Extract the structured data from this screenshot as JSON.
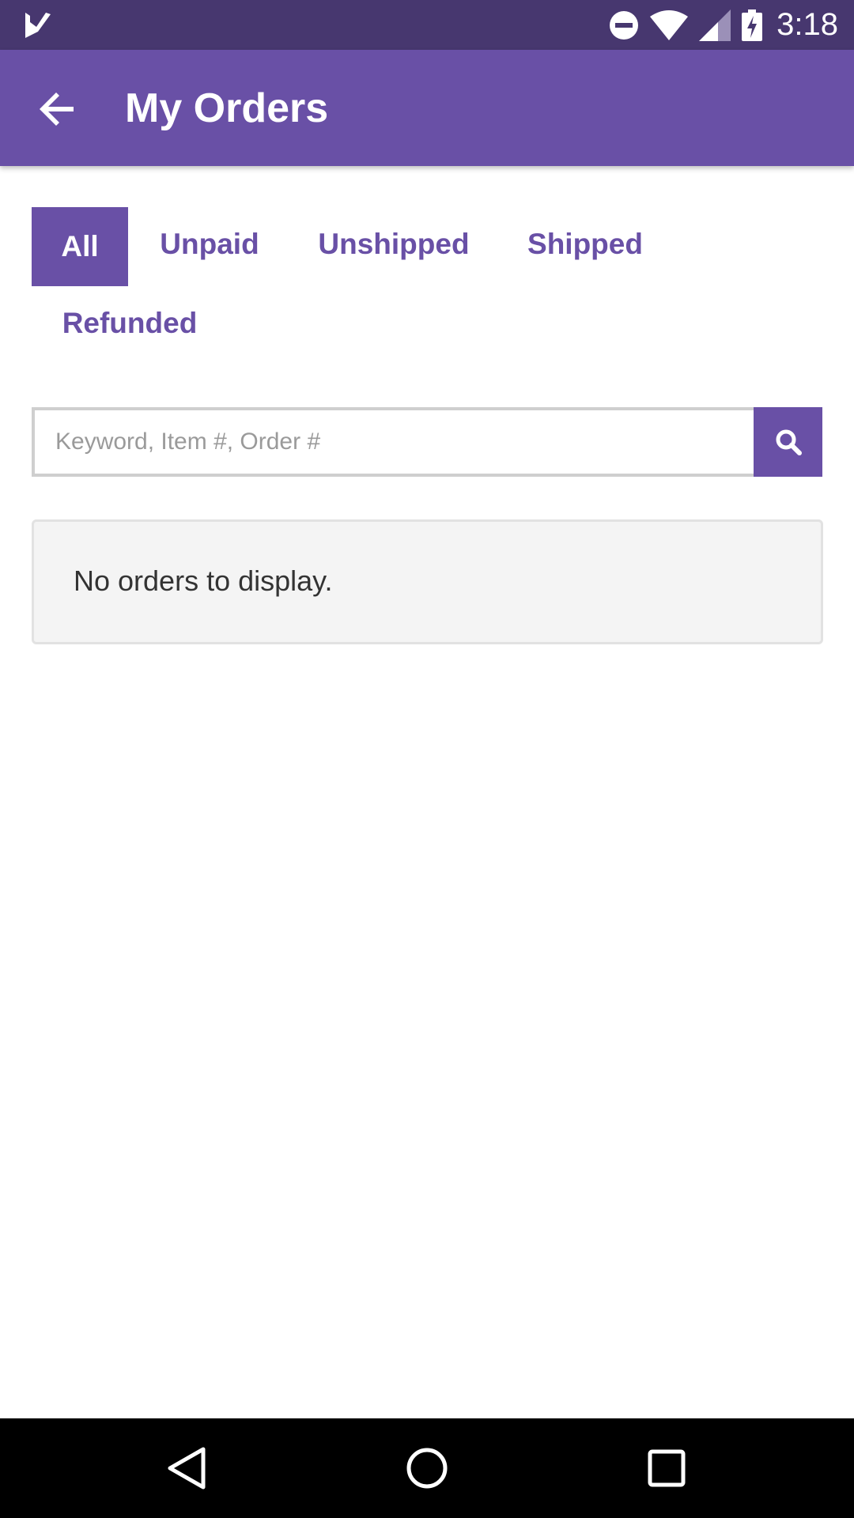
{
  "status_bar": {
    "time": "3:18",
    "icons": [
      "app-check-icon",
      "do-not-disturb-icon",
      "wifi-icon",
      "cell-signal-icon",
      "battery-charging-icon"
    ]
  },
  "app_bar": {
    "title": "My Orders",
    "back_icon": "arrow-back-icon"
  },
  "tabs": [
    {
      "label": "All",
      "active": true
    },
    {
      "label": "Unpaid",
      "active": false
    },
    {
      "label": "Unshipped",
      "active": false
    },
    {
      "label": "Shipped",
      "active": false
    },
    {
      "label": "Refunded",
      "active": false
    }
  ],
  "search": {
    "placeholder": "Keyword, Item #, Order #",
    "value": "",
    "icon": "search-icon"
  },
  "empty_state": {
    "message": "No orders to display."
  },
  "nav_bar": {
    "icons": [
      "back-triangle-icon",
      "home-circle-icon",
      "recents-square-icon"
    ]
  },
  "colors": {
    "status_bar": "#47376f",
    "primary": "#6950a6",
    "empty_bg": "#f4f4f4"
  }
}
